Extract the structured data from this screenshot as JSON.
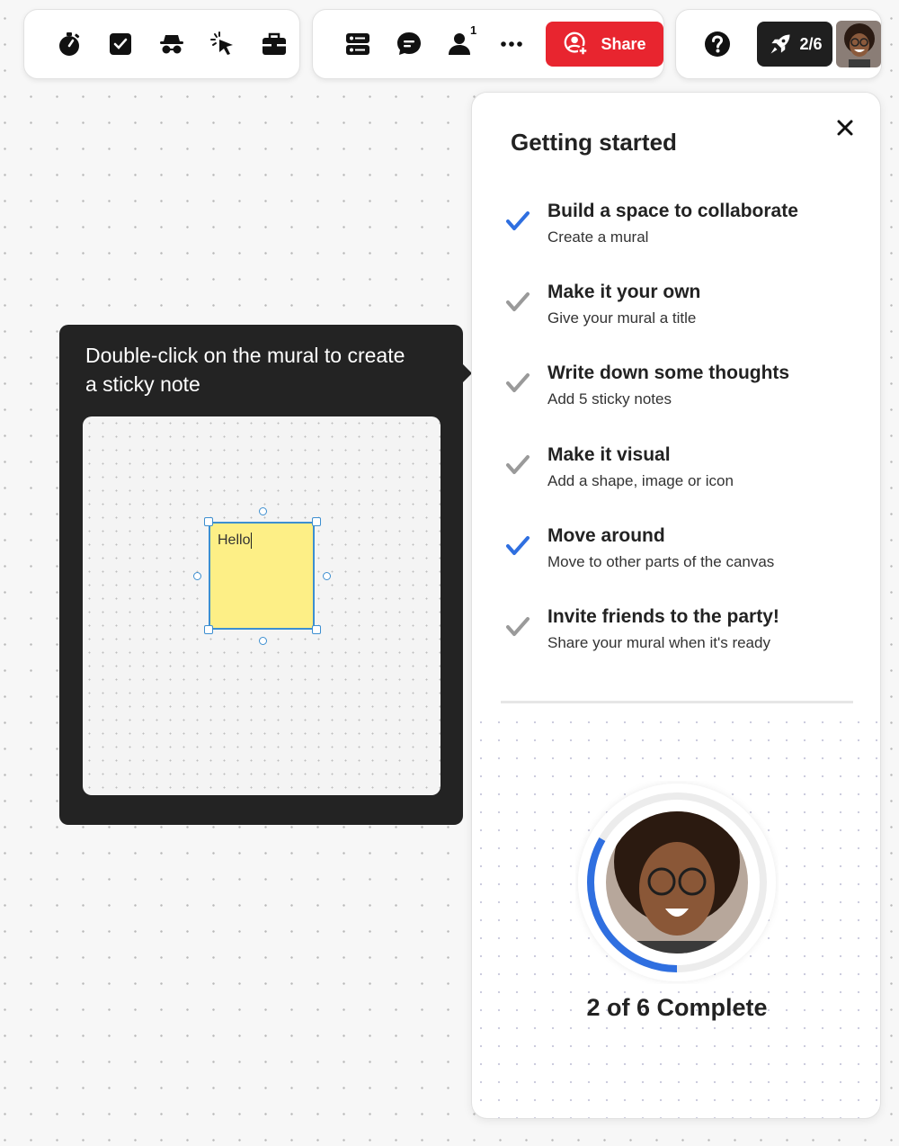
{
  "toolbar": {
    "left_tools": [
      {
        "icon": "timer-icon"
      },
      {
        "icon": "voting-icon"
      },
      {
        "icon": "private-mode-icon"
      },
      {
        "icon": "laser-pointer-icon"
      },
      {
        "icon": "toolbox-icon"
      }
    ],
    "mid_tools": [
      {
        "icon": "outline-icon"
      },
      {
        "icon": "comments-icon"
      },
      {
        "icon": "collaborators-icon",
        "count": "1"
      },
      {
        "icon": "more-icon"
      }
    ],
    "share_label": "Share",
    "progress_label": "2/6"
  },
  "tooltip": {
    "text": "Double-click on the mural to create a sticky note",
    "sticky_text": "Hello"
  },
  "panel": {
    "title": "Getting started",
    "tasks": [
      {
        "title": "Build a space to collaborate",
        "subtitle": "Create a mural",
        "done": true
      },
      {
        "title": "Make it your own",
        "subtitle": "Give your mural a title",
        "done": false
      },
      {
        "title": "Write down some thoughts",
        "subtitle": "Add 5 sticky notes",
        "done": false
      },
      {
        "title": "Make it visual",
        "subtitle": "Add a shape, image or icon",
        "done": false
      },
      {
        "title": "Move around",
        "subtitle": "Move to other parts of the canvas",
        "done": true
      },
      {
        "title": "Invite friends to the party!",
        "subtitle": "Share your mural when it's ready",
        "done": false
      }
    ],
    "completed": 2,
    "total": 6,
    "complete_text": "2 of 6 Complete"
  },
  "colors": {
    "accent_blue": "#2f6fe0",
    "share_red": "#e8252f",
    "pending_gray": "#9a9a9a"
  }
}
